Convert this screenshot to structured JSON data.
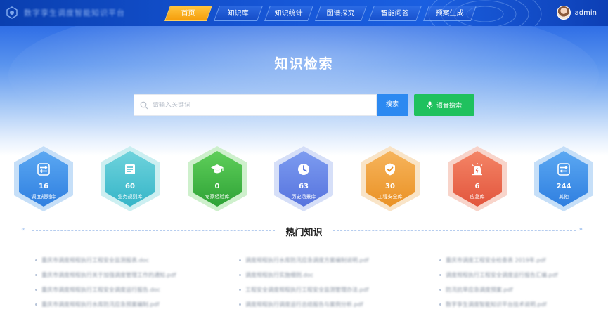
{
  "header": {
    "logo_text": "数字孪生调度智能知识平台",
    "nav": [
      {
        "label": "首页",
        "active": true
      },
      {
        "label": "知识库",
        "active": false
      },
      {
        "label": "知识统计",
        "active": false
      },
      {
        "label": "图谱探究",
        "active": false
      },
      {
        "label": "智能问答",
        "active": false
      },
      {
        "label": "预案生成",
        "active": false
      }
    ],
    "username": "admin"
  },
  "hero": {
    "title": "知识检索",
    "search_placeholder": "请输入关键词",
    "search_button": "搜索",
    "voice_button": "语音搜索"
  },
  "categories": [
    {
      "count": "16",
      "label": "调度规则库",
      "color_top": "#5ba8f2",
      "color_bottom": "#2f7fe0",
      "glow": "#bcd9f7",
      "icon": "sliders-icon"
    },
    {
      "count": "60",
      "label": "业务规则库",
      "color_top": "#6fd3dc",
      "color_bottom": "#35b5c8",
      "glow": "#c3ecef",
      "icon": "book-icon"
    },
    {
      "count": "0",
      "label": "专家经验库",
      "color_top": "#5fcf5a",
      "color_bottom": "#2ea236",
      "glow": "#c6edc3",
      "icon": "graduation-cap-icon"
    },
    {
      "count": "63",
      "label": "历史场景库",
      "color_top": "#7d9cf0",
      "color_bottom": "#5673de",
      "glow": "#cfd9f7",
      "icon": "clock-icon"
    },
    {
      "count": "30",
      "label": "工程安全库",
      "color_top": "#f6b45c",
      "color_bottom": "#ea9225",
      "glow": "#f8dfbd",
      "icon": "shield-check-icon"
    },
    {
      "count": "6",
      "label": "应急库",
      "color_top": "#f48566",
      "color_bottom": "#e2553d",
      "glow": "#f7cdc1",
      "icon": "alarm-icon"
    },
    {
      "count": "244",
      "label": "其他",
      "color_top": "#5ba8f2",
      "color_bottom": "#2f7fe0",
      "glow": "#bcd9f7",
      "icon": "sliders-icon"
    }
  ],
  "hot": {
    "title": "热门知识",
    "columns": [
      [
        "重庆市调度规程执行工程安全监测报表.doc",
        "重庆市调度规程执行关于加强调度管理工作的通知.pdf",
        "重庆市调度规程执行工程安全调度运行报告.doc",
        "重庆市调度规程执行水库防汛应急预案编制.pdf"
      ],
      [
        "调度规程执行水库防汛应急调度方案编制说明.pdf",
        "调度规程执行实施细则.doc",
        "工程安全调度规程执行工程安全监测管理办法.pdf",
        "调度规程执行调度运行总结报告与案例分析.pdf"
      ],
      [
        "重庆市调度工程安全检查表 2019年.pdf",
        "调度规程执行工程安全调度运行报告汇编.pdf",
        "防汛抗旱应急调度预案.pdf",
        "数字孪生调度智能知识平台技术说明.pdf"
      ]
    ]
  },
  "colors": {
    "header_bg": "#1656d6",
    "nav_active": "#f59d0b",
    "search_button": "#2c89f1",
    "voice_button": "#1fc15e"
  }
}
